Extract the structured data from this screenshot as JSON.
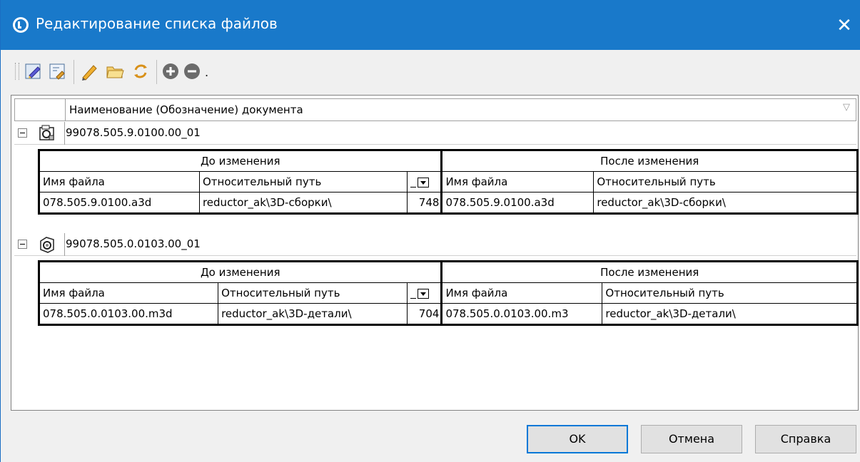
{
  "window": {
    "title": "Редактирование списка файлов",
    "close_glyph": "✕"
  },
  "toolbar": {
    "icons": [
      "edit-document-icon",
      "replace-document-icon",
      "pencil-icon",
      "open-folder-icon",
      "refresh-icon",
      "add-icon",
      "remove-icon"
    ],
    "more_glyph": "."
  },
  "grid": {
    "column_header": "Наименование (Обозначение) документа",
    "filter_glyph": "▽",
    "documents": [
      {
        "name": "99078.505.9.0100.00_01",
        "before_label": "До изменения",
        "after_label": "После изменения",
        "col_filename": "Имя файла",
        "col_path": "Относительный путь",
        "row": {
          "before_file": "078.505.9.0100.a3d",
          "before_path": "reductor_ak\\3D-сборки\\",
          "number": "748",
          "after_file": "078.505.9.0100.a3d",
          "after_path": "reductor_ak\\3D-сборки\\"
        }
      },
      {
        "name": "99078.505.0.0103.00_01",
        "before_label": "До изменения",
        "after_label": "После изменения",
        "col_filename": "Имя файла",
        "col_path": "Относительный путь",
        "row": {
          "before_file": "078.505.0.0103.00.m3d",
          "before_path": "reductor_ak\\3D-детали\\",
          "number": "704",
          "after_file": "078.505.0.0103.00.m3",
          "after_path": "reductor_ak\\3D-детали\\"
        }
      }
    ]
  },
  "buttons": {
    "ok": "OK",
    "cancel": "Отмена",
    "help": "Справка"
  }
}
